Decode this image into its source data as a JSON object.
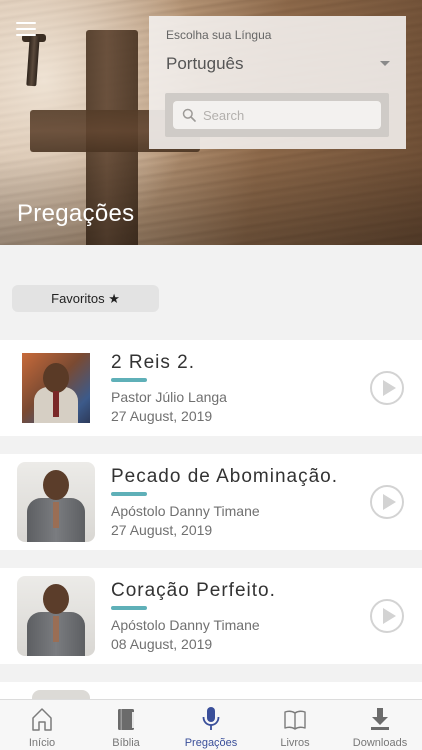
{
  "header": {
    "title": "Pregações",
    "menu_icon": "hamburger-icon"
  },
  "language_panel": {
    "label": "Escolha sua Língua",
    "selected": "Português",
    "search_placeholder": "Search"
  },
  "favorites": {
    "label": "Favoritos ★"
  },
  "sermons": [
    {
      "title": "2 Reis 2.",
      "author": "Pastor Júlio Langa",
      "date": "27 August, 2019"
    },
    {
      "title": "Pecado de Abominação.",
      "author": "Apóstolo Danny Timane",
      "date": "27 August, 2019"
    },
    {
      "title": "Coração Perfeito.",
      "author": "Apóstolo Danny Timane",
      "date": "08 August, 2019"
    }
  ],
  "bottom_nav": {
    "items": [
      {
        "label": "Início",
        "icon": "home-icon"
      },
      {
        "label": "Bíblia",
        "icon": "bible-icon"
      },
      {
        "label": "Pregações",
        "icon": "microphone-icon"
      },
      {
        "label": "Livros",
        "icon": "book-icon"
      },
      {
        "label": "Downloads",
        "icon": "download-icon"
      }
    ],
    "active_index": 2
  },
  "colors": {
    "accent_bar": "#5fb0b8",
    "nav_active": "#3a4f9a",
    "nav_inactive": "#777777"
  }
}
